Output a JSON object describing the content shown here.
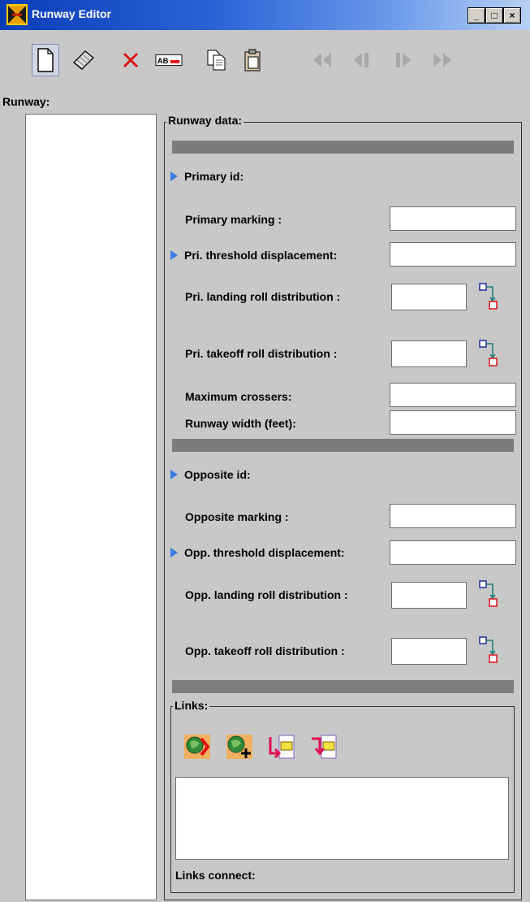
{
  "window": {
    "title": "Runway Editor",
    "minimize": "_",
    "maximize": "□",
    "close": "×"
  },
  "toolbar": {
    "icons": [
      "new-document-icon",
      "eraser-icon",
      "delete-icon",
      "rename-icon",
      "copy-icon",
      "paste-icon",
      "first-icon",
      "previous-icon",
      "next-icon",
      "last-icon"
    ]
  },
  "runway_list_label": "Runway:",
  "runway_data": {
    "legend": "Runway data:",
    "primary_id": "Primary id:",
    "primary_marking": {
      "label": "Primary marking :",
      "value": ""
    },
    "pri_threshold": {
      "label": "Pri. threshold displacement:",
      "value": ""
    },
    "pri_landing": {
      "label": "Pri. landing roll distribution :",
      "value": ""
    },
    "pri_takeoff": {
      "label": "Pri. takeoff roll distribution :",
      "value": ""
    },
    "max_crossers": {
      "label": "Maximum crossers:",
      "value": ""
    },
    "runway_width": {
      "label": "Runway width (feet):",
      "value": ""
    },
    "opposite_id": "Opposite id:",
    "opposite_marking": {
      "label": "Opposite marking :",
      "value": ""
    },
    "opp_threshold": {
      "label": "Opp. threshold displacement:",
      "value": ""
    },
    "opp_landing": {
      "label": "Opp. landing roll distribution :",
      "value": ""
    },
    "opp_takeoff": {
      "label": "Opp. takeoff roll distribution :",
      "value": ""
    }
  },
  "links": {
    "legend": "Links:",
    "connect_label": "Links connect:",
    "icons": [
      "globe-link-icon",
      "globe-add-icon",
      "link-in-icon",
      "link-out-icon"
    ]
  },
  "colors": {
    "title_bar": "#0b3cb8",
    "background": "#c8c8c8",
    "separator": "#7c7c7c",
    "accent_arrow": "#3b7de0"
  }
}
